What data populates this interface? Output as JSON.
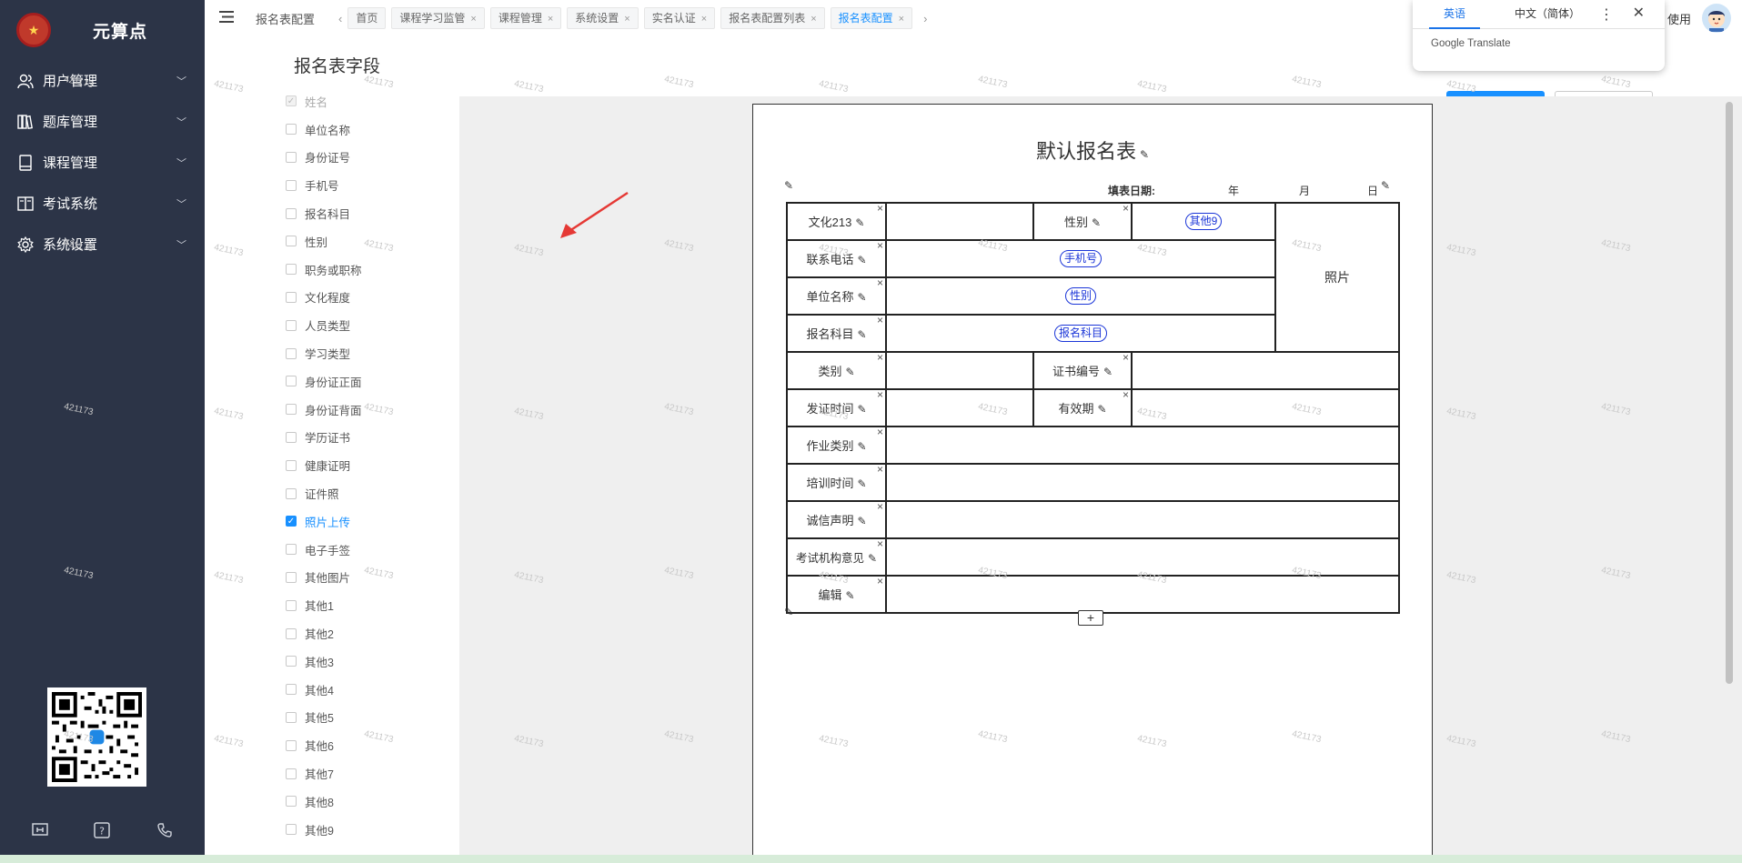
{
  "app": {
    "name": "元算点"
  },
  "sidebar": {
    "items": [
      {
        "label": "用户管理",
        "icon": "users-icon"
      },
      {
        "label": "题库管理",
        "icon": "books-icon"
      },
      {
        "label": "课程管理",
        "icon": "book-icon"
      },
      {
        "label": "考试系统",
        "icon": "exam-icon"
      },
      {
        "label": "系统设置",
        "icon": "gear-icon"
      }
    ]
  },
  "topbar": {
    "current": "报名表配置",
    "tabs": [
      {
        "label": "首页",
        "closable": false,
        "active": false
      },
      {
        "label": "课程学习监管",
        "closable": true,
        "active": false
      },
      {
        "label": "课程管理",
        "closable": true,
        "active": false
      },
      {
        "label": "系统设置",
        "closable": true,
        "active": false
      },
      {
        "label": "实名认证",
        "closable": true,
        "active": false
      },
      {
        "label": "报名表配置列表",
        "closable": true,
        "active": false
      },
      {
        "label": "报名表配置",
        "closable": true,
        "active": true
      }
    ],
    "use_label": "使用"
  },
  "translate": {
    "tab_en": "英语",
    "tab_zh": "中文（简体）",
    "brand": "Google Translate"
  },
  "fields_panel": {
    "title": "报名表字段",
    "fields": [
      {
        "label": "姓名",
        "checked": true,
        "disabled": true
      },
      {
        "label": "单位名称",
        "checked": false,
        "disabled": false
      },
      {
        "label": "身份证号",
        "checked": false,
        "disabled": false
      },
      {
        "label": "手机号",
        "checked": false,
        "disabled": false
      },
      {
        "label": "报名科目",
        "checked": false,
        "disabled": false
      },
      {
        "label": "性别",
        "checked": false,
        "disabled": false
      },
      {
        "label": "职务或职称",
        "checked": false,
        "disabled": false
      },
      {
        "label": "文化程度",
        "checked": false,
        "disabled": false
      },
      {
        "label": "人员类型",
        "checked": false,
        "disabled": false
      },
      {
        "label": "学习类型",
        "checked": false,
        "disabled": false
      },
      {
        "label": "身份证正面",
        "checked": false,
        "disabled": false
      },
      {
        "label": "身份证背面",
        "checked": false,
        "disabled": false
      },
      {
        "label": "学历证书",
        "checked": false,
        "disabled": false
      },
      {
        "label": "健康证明",
        "checked": false,
        "disabled": false
      },
      {
        "label": "证件照",
        "checked": false,
        "disabled": false
      },
      {
        "label": "照片上传",
        "checked": true,
        "disabled": false
      },
      {
        "label": "电子手签",
        "checked": false,
        "disabled": false
      },
      {
        "label": "其他图片",
        "checked": false,
        "disabled": false
      },
      {
        "label": "其他1",
        "checked": false,
        "disabled": false
      },
      {
        "label": "其他2",
        "checked": false,
        "disabled": false
      },
      {
        "label": "其他3",
        "checked": false,
        "disabled": false
      },
      {
        "label": "其他4",
        "checked": false,
        "disabled": false
      },
      {
        "label": "其他5",
        "checked": false,
        "disabled": false
      },
      {
        "label": "其他6",
        "checked": false,
        "disabled": false
      },
      {
        "label": "其他7",
        "checked": false,
        "disabled": false
      },
      {
        "label": "其他8",
        "checked": false,
        "disabled": false
      },
      {
        "label": "其他9",
        "checked": false,
        "disabled": false
      }
    ]
  },
  "form": {
    "title": "默认报名表",
    "date_label": "填表日期:",
    "year": "年",
    "month": "月",
    "day": "日",
    "photo": "照片",
    "rows": {
      "r1_label": "文化213",
      "r1_sex_label": "性别",
      "r1_sex_tag": "其他9",
      "r2_label": "联系电话",
      "r2_tag": "手机号",
      "r3_label": "单位名称",
      "r3_tag": "性别",
      "r4_label": "报名科目",
      "r4_tag": "报名科目",
      "r5_label": "类别",
      "r5_cert_label": "证书编号",
      "r6_label": "发证时间",
      "r6_valid_label": "有效期",
      "r7_label": "作业类别",
      "r8_label": "培训时间",
      "r9_label": "诚信声明",
      "r10_label": "考试机构意见",
      "r11_label": "编辑"
    },
    "add_symbol": "+"
  },
  "watermark_text": "421173",
  "colors": {
    "sidebar": "#2c3447",
    "accent": "#1890ff",
    "tag": "#1a35d8"
  }
}
